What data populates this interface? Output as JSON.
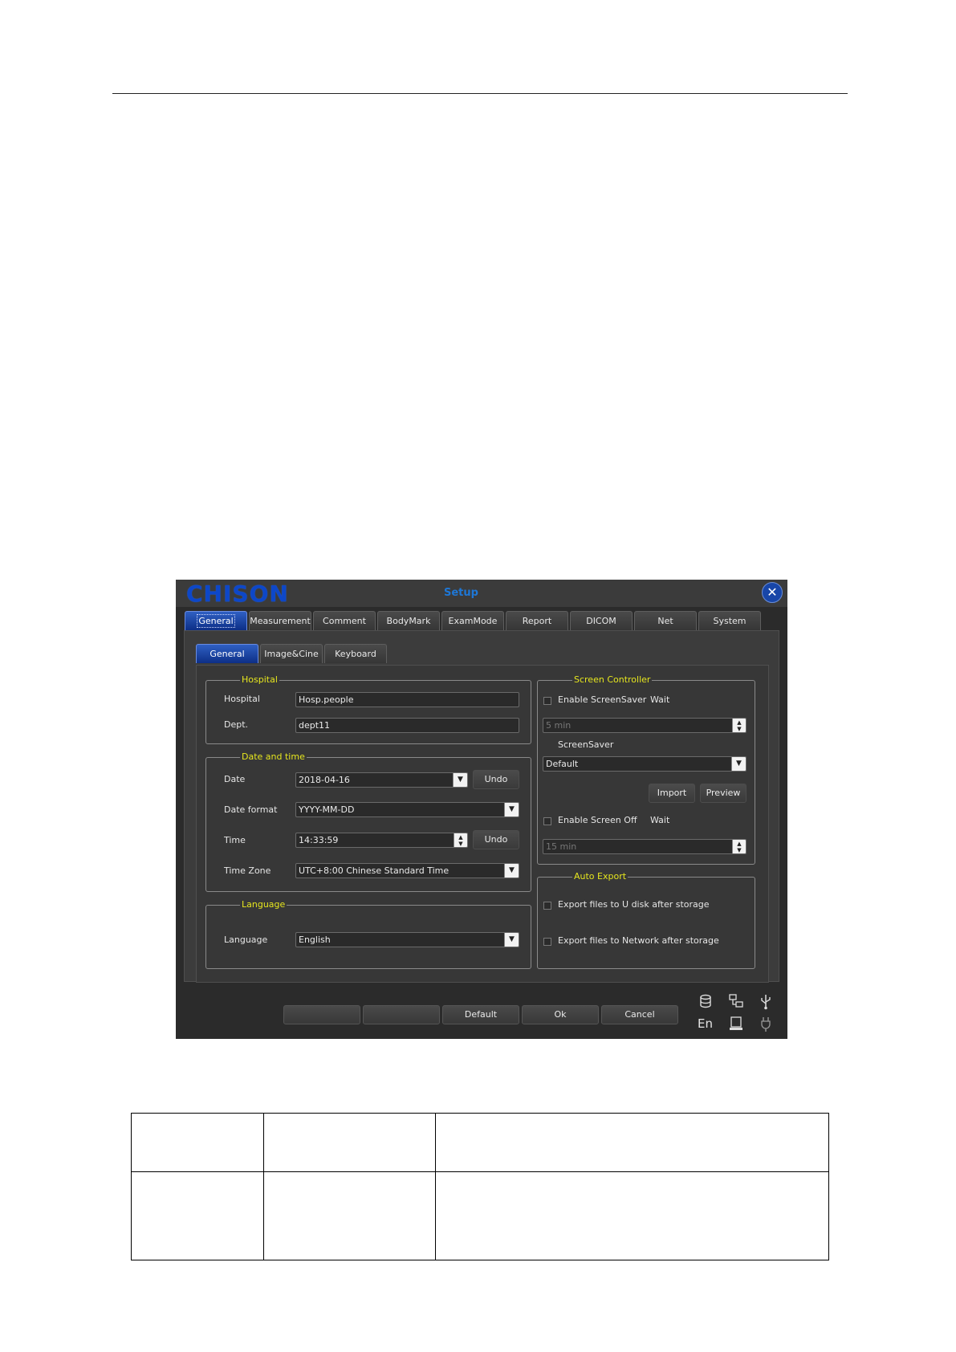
{
  "dialog": {
    "logo_text": "CHISON",
    "title": "Setup",
    "close_symbol": "✕",
    "tabs": [
      "General",
      "Measurement",
      "Comment",
      "BodyMark",
      "ExamMode",
      "Report",
      "DICOM",
      "Net",
      "System"
    ],
    "subtabs": [
      "General",
      "Image&Cine",
      "Keyboard"
    ],
    "hospital_group": {
      "title": "Hospital",
      "hospital_label": "Hospital",
      "hospital_value": "Hosp.people",
      "dept_label": "Dept.",
      "dept_value": "dept11"
    },
    "datetime_group": {
      "title": "Date and time",
      "date_label": "Date",
      "date_value": "2018-04-16",
      "undo_label": "Undo",
      "date_format_label": "Date format",
      "date_format_value": "YYYY-MM-DD",
      "time_label": "Time",
      "time_value": "14:33:59",
      "timezone_label": "Time Zone",
      "timezone_value": "UTC+8:00 Chinese Standard Time"
    },
    "language_group": {
      "title": "Language",
      "language_label": "Language",
      "language_value": "English"
    },
    "screen_group": {
      "title": "Screen Controller",
      "screensaver_check_label": "Enable ScreenSaver",
      "wait_label": "Wait",
      "screensaver_wait_value": "5 min",
      "screensaver_label": "ScreenSaver",
      "screensaver_value": "Default",
      "import_label": "Import",
      "preview_label": "Preview",
      "screenoff_check_label": "Enable Screen Off",
      "screenoff_wait_value": "15 min"
    },
    "export_group": {
      "title": "Auto Export",
      "udisk_label": "Export files to U disk after storage",
      "network_label": "Export files to Network after storage"
    },
    "bottom_buttons": [
      "",
      "",
      "Default",
      "Ok",
      "Cancel"
    ],
    "status": {
      "lang_code": "En",
      "icons": [
        "database-icon",
        "network-icon",
        "usb-icon",
        "disk-icon",
        "power-plug-icon"
      ]
    },
    "colors": {
      "background": "#2b2b2b",
      "panel": "#3c3c3c",
      "group_title": "#e6e61e",
      "tab_active": "#1846a8",
      "logo": "#0d47c9"
    }
  }
}
